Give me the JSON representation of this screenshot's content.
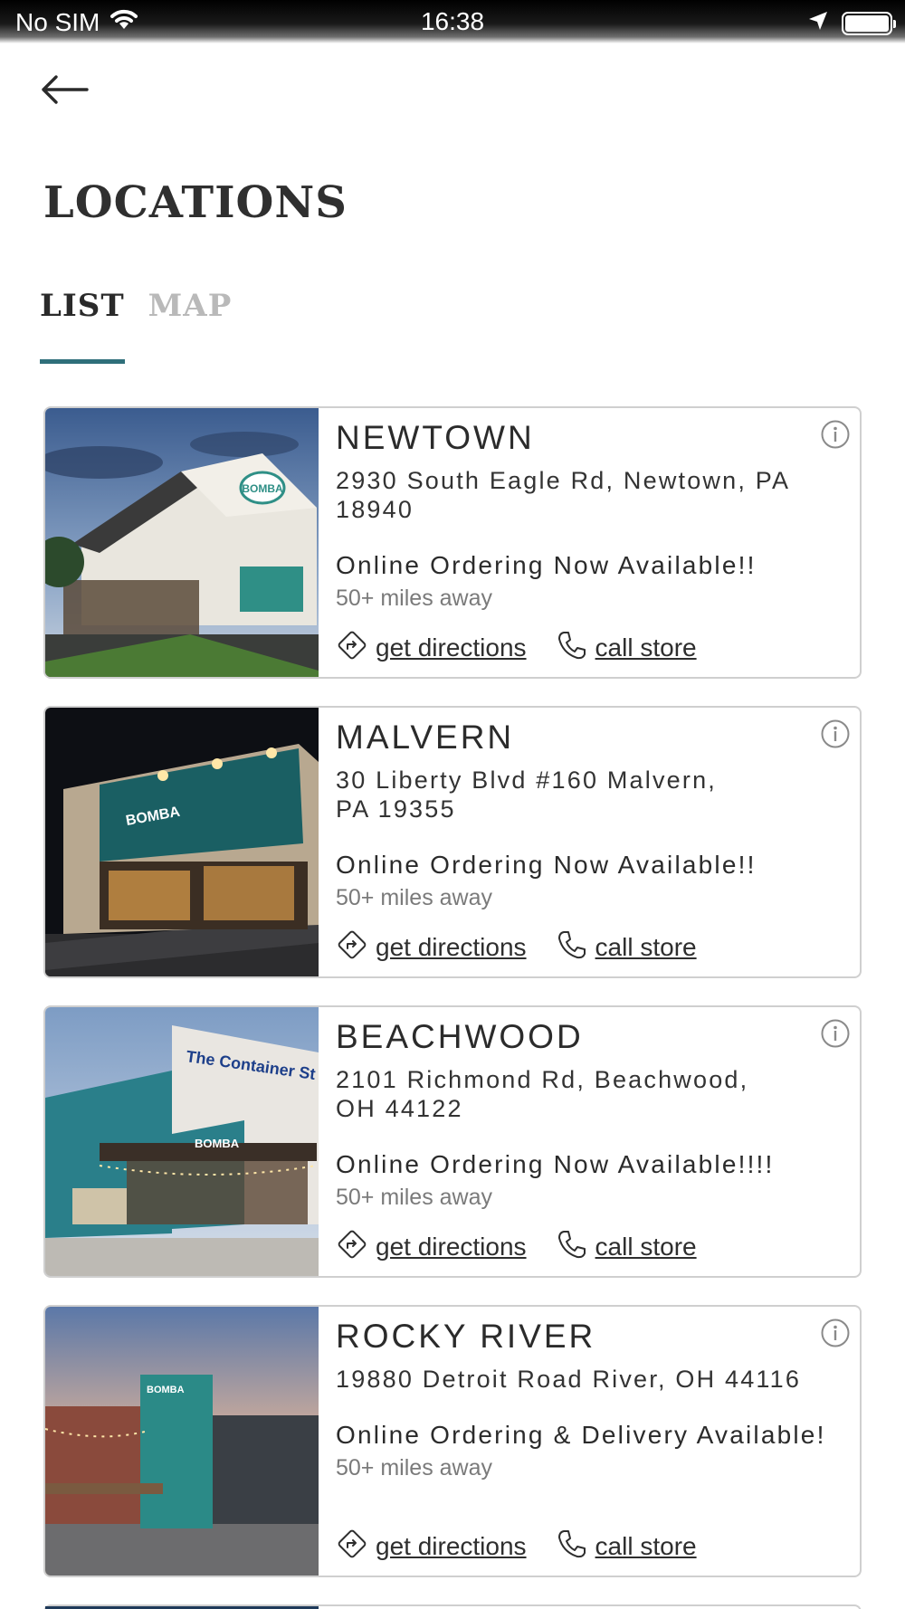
{
  "status_bar": {
    "carrier": "No SIM",
    "time": "16:38"
  },
  "header": {
    "title": "LOCATIONS"
  },
  "tabs": [
    {
      "label": "LIST",
      "active": true
    },
    {
      "label": "MAP",
      "active": false
    }
  ],
  "colors": {
    "accent": "#2f6f7a",
    "card_border": "#cfcfcf"
  },
  "icons": {
    "back": "arrow-left-icon",
    "info": "info-circle-icon",
    "directions": "directions-icon",
    "call": "phone-icon"
  },
  "locations": [
    {
      "name": "NEWTOWN",
      "address": "2930 South Eagle Rd, Newtown, PA 18940",
      "ordering": "Online Ordering Now Available!!",
      "distance": "50+ miles away",
      "directions_label": "get directions",
      "call_label": "call store",
      "sign": "BOMBA"
    },
    {
      "name": "MALVERN",
      "address": "30 Liberty Blvd #160 Malvern, PA 19355",
      "ordering": "Online Ordering Now Available!!",
      "distance": "50+ miles away",
      "directions_label": "get directions",
      "call_label": "call store",
      "sign": "BOMBA"
    },
    {
      "name": "BEACHWOOD",
      "address": "2101 Richmond Rd, Beachwood, OH 44122",
      "ordering": "Online Ordering Now Available!!!!",
      "distance": "50+ miles away",
      "directions_label": "get directions",
      "call_label": "call store",
      "sign": "BOMBA",
      "sign2": "The Container St"
    },
    {
      "name": "ROCKY RIVER",
      "address": "19880 Detroit Road River, OH 44116",
      "ordering": "Online Ordering & Delivery Available!",
      "distance": "50+ miles away",
      "directions_label": "get directions",
      "call_label": "call store",
      "sign": "BOMBA"
    }
  ]
}
